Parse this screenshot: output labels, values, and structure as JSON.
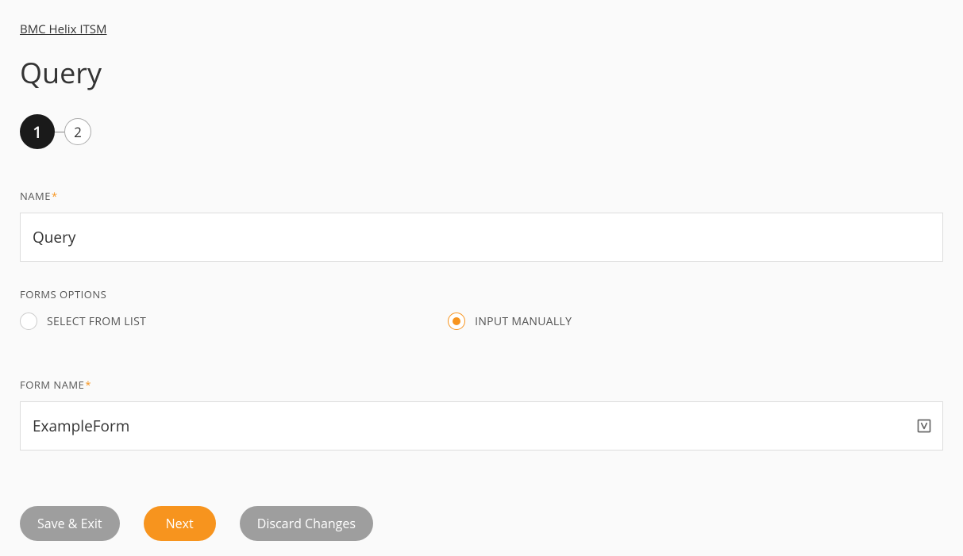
{
  "breadcrumb": "BMC Helix ITSM",
  "page_title": "Query",
  "stepper": {
    "step1": "1",
    "step2": "2"
  },
  "fields": {
    "name": {
      "label": "NAME",
      "value": "Query"
    },
    "forms_options": {
      "label": "FORMS OPTIONS",
      "option_select": "SELECT FROM LIST",
      "option_manual": "INPUT MANUALLY"
    },
    "form_name": {
      "label": "FORM NAME",
      "value": "ExampleForm"
    }
  },
  "buttons": {
    "save_exit": "Save & Exit",
    "next": "Next",
    "discard": "Discard Changes"
  }
}
